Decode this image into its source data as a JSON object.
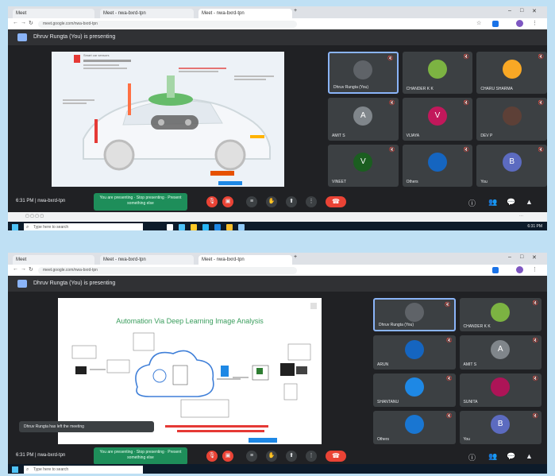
{
  "browser": {
    "tabs": [
      "Meet",
      "Meet - nwa-bxrd-tpn",
      "Meet - nwa-bxrd-tpn"
    ],
    "url": "meet.google.com/nwa-bxrd-tpn"
  },
  "meeting": {
    "presenting_label": "Dhruv Rungta (You) is presenting",
    "time_code": "6:31 PM | nwa-bxrd-tpn",
    "presenting_notice": "You are presenting · Stop presenting · Present something else"
  },
  "screen1": {
    "participants": [
      {
        "name": "Dhruv Rungta (You)",
        "initial": "",
        "color": "#5f6368",
        "highlight": true
      },
      {
        "name": "CHANDER K K",
        "initial": "",
        "color": "#7cb342"
      },
      {
        "name": "CHARU SHARMA",
        "initial": "",
        "color": "#f9a825"
      },
      {
        "name": "AMIT S",
        "initial": "A",
        "color": "#80868b"
      },
      {
        "name": "VIJAYA",
        "initial": "V",
        "color": "#c2185b"
      },
      {
        "name": "DEV P",
        "initial": "",
        "color": "#5d4037"
      },
      {
        "name": "VINEET",
        "initial": "V",
        "color": "#1b5e20"
      },
      {
        "name": "Others",
        "initial": "",
        "color": "#1565c0"
      },
      {
        "name": "You",
        "initial": "B",
        "color": "#5c6bc0"
      }
    ],
    "slide_caption": "Smart car sensors"
  },
  "screen2": {
    "participants": [
      {
        "name": "Dhruv Rungta (You)",
        "initial": "",
        "color": "#5f6368",
        "highlight": true
      },
      {
        "name": "CHANDER K K",
        "initial": "",
        "color": "#7cb342"
      },
      {
        "name": "ARUN",
        "initial": "",
        "color": "#1565c0"
      },
      {
        "name": "AMIT S",
        "initial": "A",
        "color": "#80868b"
      },
      {
        "name": "SHANTANU",
        "initial": "",
        "color": "#1e88e5"
      },
      {
        "name": "SUNITA",
        "initial": "",
        "color": "#ad1457"
      },
      {
        "name": "Others",
        "initial": "",
        "color": "#1976d2"
      },
      {
        "name": "You",
        "initial": "B",
        "color": "#5c6bc0"
      }
    ],
    "slide_title": "Automation Via Deep Learning Image Analysis",
    "toast": "Dhruv Rungta has left the meeting"
  },
  "taskbar": {
    "search_placeholder": "Type here to search",
    "clock": "6:31 PM"
  }
}
